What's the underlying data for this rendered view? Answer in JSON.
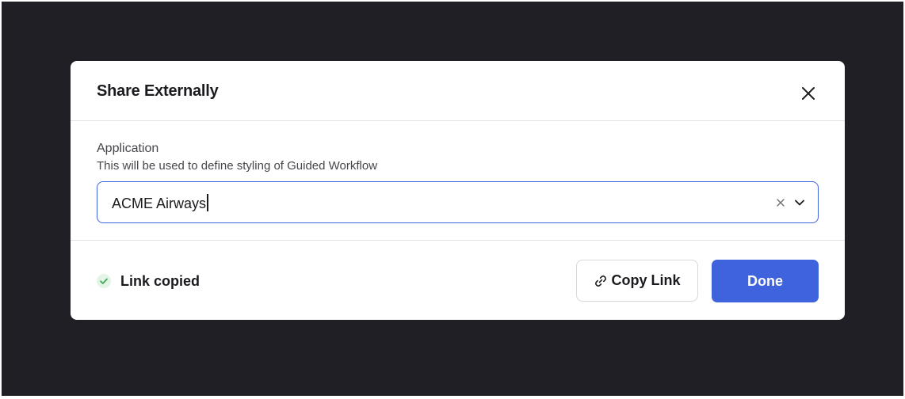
{
  "dialog": {
    "title": "Share Externally"
  },
  "field": {
    "label": "Application",
    "help": "This will be used to define styling of Guided Workflow",
    "value": "ACME Airways"
  },
  "footer": {
    "status": "Link copied",
    "copy_label": "Copy Link",
    "done_label": "Done"
  },
  "icons": {
    "close": "close-icon",
    "clear": "clear-icon",
    "chevron": "chevron-down-icon",
    "check": "check-circle-icon",
    "link": "link-icon"
  },
  "colors": {
    "backdrop": "#1f1f25",
    "accent": "#3e63dd",
    "success": "#46a758"
  }
}
